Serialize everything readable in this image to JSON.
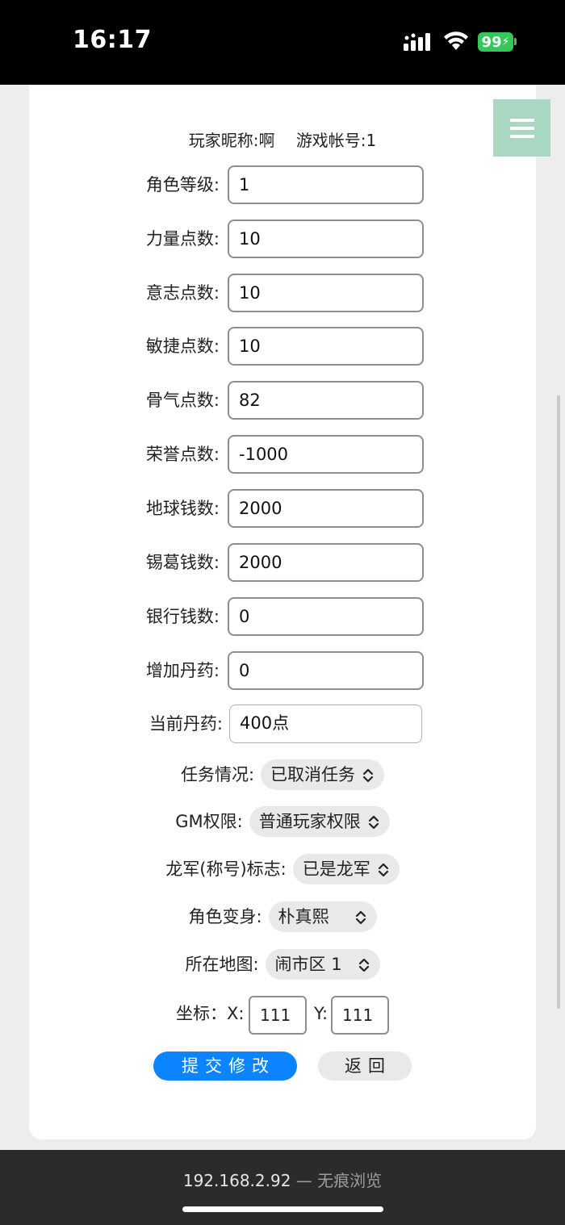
{
  "status_bar": {
    "time": "16:17",
    "battery": "99"
  },
  "header": {
    "nickname": "玩家昵称:啊",
    "account": "游戏帐号:1"
  },
  "fields": [
    {
      "label": "角色等级:",
      "value": "1"
    },
    {
      "label": "力量点数:",
      "value": "10"
    },
    {
      "label": "意志点数:",
      "value": "10"
    },
    {
      "label": "敏捷点数:",
      "value": "10"
    },
    {
      "label": "骨气点数:",
      "value": "82"
    },
    {
      "label": "荣誉点数:",
      "value": "-1000"
    },
    {
      "label": "地球钱数:",
      "value": "2000"
    },
    {
      "label": "锡葛钱数:",
      "value": "2000"
    },
    {
      "label": "银行钱数:",
      "value": "0"
    },
    {
      "label": "增加丹药:",
      "value": "0"
    },
    {
      "label": "当前丹药:",
      "value": "400点"
    }
  ],
  "selects": [
    {
      "label": "任务情况:",
      "value": "已取消任务"
    },
    {
      "label": "GM权限:",
      "value": "普通玩家权限"
    },
    {
      "label": "龙军(称号)标志:",
      "value": "已是龙军"
    },
    {
      "label": "角色变身:",
      "value": "朴真熙"
    },
    {
      "label": "所在地图:",
      "value": "闹市区 1"
    }
  ],
  "coords": {
    "label": "坐标：X:",
    "x": "111",
    "y_label": "Y:",
    "y": "111"
  },
  "buttons": {
    "submit": "提交修改",
    "back": "返回"
  },
  "browser": {
    "url": "192.168.2.92",
    "separator": "—",
    "mode": "无痕浏览"
  },
  "colors": {
    "accent": "#0a84ff",
    "menu": "#a8d8c2",
    "battery": "#34c759"
  }
}
